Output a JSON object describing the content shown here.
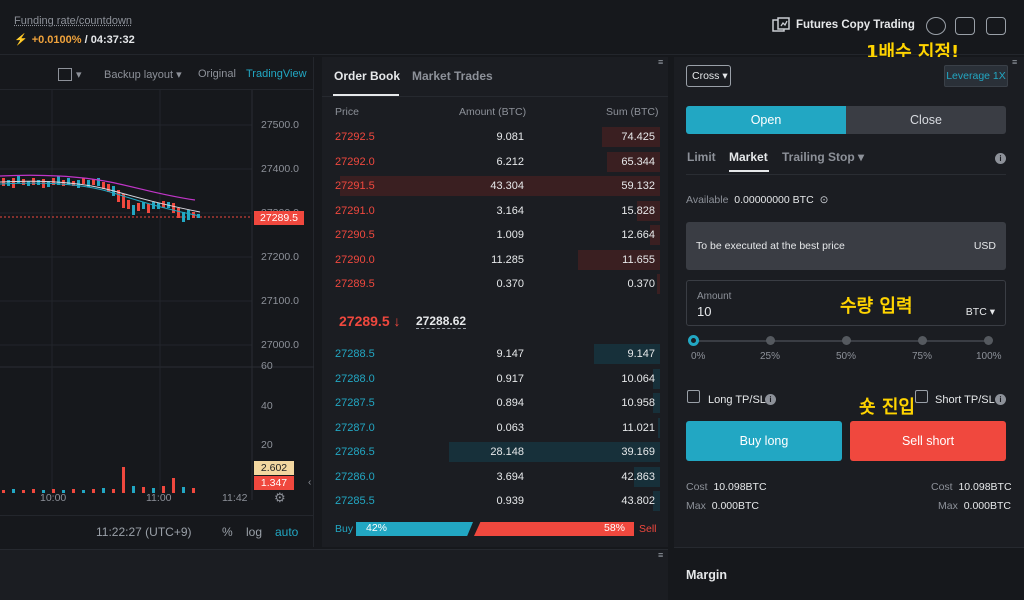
{
  "topbar": {
    "funding_label": "Funding rate/countdown",
    "funding_rate": "+0.0100%",
    "countdown": "/ 04:37:32",
    "futures_copy": "Futures Copy Trading",
    "annotation_leverage": "1배수 지정!"
  },
  "chart": {
    "toolbar": {
      "backup_layout": "Backup layout",
      "original": "Original",
      "tradingview": "TradingView"
    },
    "price_ticks": [
      "27500.0",
      "27400.0",
      "27300.0",
      "27200.0",
      "27100.0",
      "27000.0"
    ],
    "current_price_tag": "27289.5",
    "volume_ticks": [
      "60",
      "40",
      "20"
    ],
    "volume_tag_1": "2.602",
    "volume_tag_2": "1.347",
    "time_ticks": [
      "10:00",
      "11:00",
      "11:42"
    ],
    "bottom": {
      "time": "11:22:27 (UTC+9)",
      "percent": "%",
      "log": "log",
      "auto": "auto"
    }
  },
  "orderbook": {
    "tabs": [
      "Order Book",
      "Market Trades"
    ],
    "headers": {
      "price": "Price",
      "amount": "Amount (BTC)",
      "sum": "Sum (BTC)"
    },
    "asks": [
      {
        "price": "27292.5",
        "amount": "9.081",
        "sum": "74.425",
        "depth": 0.175
      },
      {
        "price": "27292.0",
        "amount": "6.212",
        "sum": "65.344",
        "depth": 0.16
      },
      {
        "price": "27291.5",
        "amount": "43.304",
        "sum": "59.132",
        "depth": 0.97
      },
      {
        "price": "27291.0",
        "amount": "3.164",
        "sum": "15.828",
        "depth": 0.07
      },
      {
        "price": "27290.5",
        "amount": "1.009",
        "sum": "12.664",
        "depth": 0.03
      },
      {
        "price": "27290.0",
        "amount": "11.285",
        "sum": "11.655",
        "depth": 0.25
      },
      {
        "price": "27289.5",
        "amount": "0.370",
        "sum": "0.370",
        "depth": 0.01
      }
    ],
    "mid_price": "27289.5 ↓",
    "mark_price": "27288.62",
    "bids": [
      {
        "price": "27288.5",
        "amount": "9.147",
        "sum": "9.147",
        "depth": 0.2
      },
      {
        "price": "27288.0",
        "amount": "0.917",
        "sum": "10.064",
        "depth": 0.02
      },
      {
        "price": "27287.5",
        "amount": "0.894",
        "sum": "10.958",
        "depth": 0.02
      },
      {
        "price": "27287.0",
        "amount": "0.063",
        "sum": "11.021",
        "depth": 0.005
      },
      {
        "price": "27286.5",
        "amount": "28.148",
        "sum": "39.169",
        "depth": 0.64
      },
      {
        "price": "27286.0",
        "amount": "3.694",
        "sum": "42.863",
        "depth": 0.08
      },
      {
        "price": "27285.5",
        "amount": "0.939",
        "sum": "43.802",
        "depth": 0.02
      }
    ],
    "buy_label": "Buy",
    "buy_pct": "42%",
    "sell_pct": "58%",
    "sell_label": "Sell"
  },
  "trade": {
    "margin_mode": "Cross",
    "leverage": "Leverage 1X",
    "open": "Open",
    "close": "Close",
    "order_types": [
      "Limit",
      "Market",
      "Trailing Stop"
    ],
    "available_label": "Available",
    "available_value": "0.00000000 BTC",
    "exec_text": "To be executed at the best price",
    "exec_unit": "USD",
    "amount_label": "Amount",
    "amount_value": "10",
    "amount_unit": "BTC",
    "annotation_amount": "수량 입력",
    "slider_labels": [
      "0%",
      "25%",
      "50%",
      "75%",
      "100%"
    ],
    "slider_value": 0,
    "long_tpsl": "Long TP/SL",
    "short_tpsl": "Short TP/SL",
    "annotation_short": "숏 진입",
    "buy_long": "Buy long",
    "sell_short": "Sell short",
    "cost_label": "Cost",
    "cost_long": "10.098BTC",
    "cost_short": "10.098BTC",
    "max_label": "Max",
    "max_long": "0.000BTC",
    "max_short": "0.000BTC",
    "margin_title": "Margin"
  },
  "colors": {
    "ask": "#f0483e",
    "bid": "#22a7c3",
    "accent": "#22a7c3",
    "annotation": "#ffd400"
  }
}
